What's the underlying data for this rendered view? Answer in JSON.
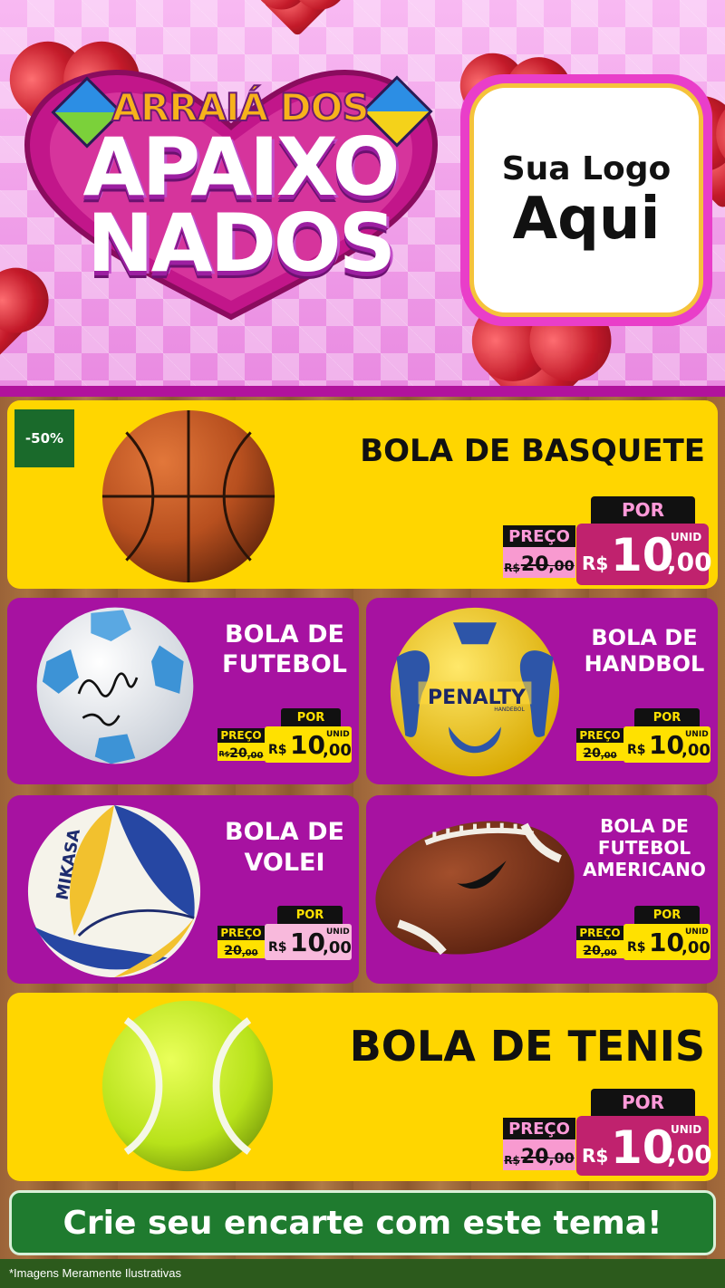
{
  "header": {
    "title_top": "ARRAIÁ DOS",
    "title_mid": "APAIXO",
    "title_bot": "NADOS",
    "logo_line1": "Sua Logo",
    "logo_line2": "Aqui"
  },
  "featured": {
    "badge": "-50%",
    "name": "BOLA DE BASQUETE",
    "por": "POR",
    "preco": "PREÇO",
    "old_rs": "R$",
    "old_int": "20",
    "old_cents": ",00",
    "new_rs": "R$",
    "new_int": "10",
    "new_cents": ",00",
    "unid": "UNID"
  },
  "products": [
    {
      "line1": "BOLA DE",
      "line2": "FUTEBOL",
      "line3": "",
      "por": "POR",
      "preco": "PREÇO",
      "old_rs": "R$",
      "old_int": "20",
      "old_cents": ",00",
      "new_rs": "R$",
      "new_int": "10",
      "new_cents": ",00",
      "unid": "UNID"
    },
    {
      "line1": "BOLA DE",
      "line2": "HANDBOL",
      "line3": "",
      "por": "POR",
      "preco": "PREÇO",
      "old_rs": "R$",
      "old_int": "20",
      "old_cents": ",00",
      "new_rs": "R$",
      "new_int": "10",
      "new_cents": ",00",
      "unid": "UNID"
    },
    {
      "line1": "BOLA DE",
      "line2": "VOLEI",
      "line3": "",
      "por": "POR",
      "preco": "PREÇO",
      "old_rs": "R$",
      "old_int": "20",
      "old_cents": ",00",
      "new_rs": "R$",
      "new_int": "10",
      "new_cents": ",00",
      "unid": "UNID"
    },
    {
      "line1": "BOLA DE",
      "line2": "FUTEBOL",
      "line3": "AMERICANO",
      "por": "POR",
      "preco": "PREÇO",
      "old_rs": "R$",
      "old_int": "20",
      "old_cents": ",00",
      "new_rs": "R$",
      "new_int": "10",
      "new_cents": ",00",
      "unid": "UNID"
    }
  ],
  "bottom_product": {
    "name": "BOLA DE TENIS",
    "por": "POR",
    "preco": "PREÇO",
    "old_rs": "R$",
    "old_int": "20",
    "old_cents": ",00",
    "new_rs": "R$",
    "new_int": "10",
    "new_cents": ",00",
    "unid": "UNID"
  },
  "ball_labels": {
    "handbol_brand": "PENALTY",
    "handbol_sub": "HANDEBOL",
    "volei_brand": "MIKASA"
  },
  "cta": {
    "label": "Crie seu encarte com este tema!"
  },
  "footer": {
    "disclaimer": "*Imagens Meramente Ilustrativas"
  },
  "colors": {
    "yellow": "#ffd600",
    "purple": "#a712a1",
    "green": "#1f7b2f",
    "pink": "#c0226e"
  }
}
